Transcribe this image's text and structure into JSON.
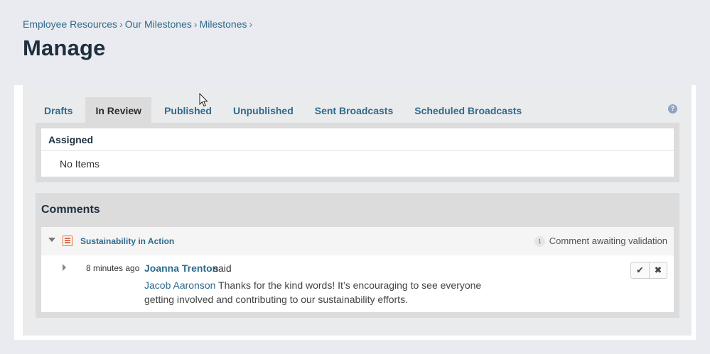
{
  "breadcrumb": {
    "items": [
      "Employee Resources",
      "Our Milestones",
      "Milestones"
    ],
    "separator": "›"
  },
  "page": {
    "title": "Manage"
  },
  "tabs": [
    {
      "label": "Drafts",
      "active": false
    },
    {
      "label": "In Review",
      "active": true
    },
    {
      "label": "Published",
      "active": false
    },
    {
      "label": "Unpublished",
      "active": false
    },
    {
      "label": "Sent Broadcasts",
      "active": false
    },
    {
      "label": "Scheduled Broadcasts",
      "active": false
    }
  ],
  "help": {
    "glyph": "?"
  },
  "assigned": {
    "heading": "Assigned",
    "empty_text": "No Items"
  },
  "comments": {
    "heading": "Comments",
    "group": {
      "title": "Sustainability in Action",
      "count": "1",
      "status": "Comment awaiting validation"
    },
    "comment": {
      "time": "8 minutes ago",
      "author": "Joanna Trenton",
      "said": "said",
      "mention": "Jacob Aaronson",
      "text": " Thanks for the kind words! It’s encouraging to see everyone getting involved and contributing to our sustainability efforts."
    },
    "actions": {
      "approve": "✔",
      "reject": "✖"
    }
  },
  "colors": {
    "link": "#2f6a8c",
    "title": "#1e2f3e",
    "background": "#eaebf0",
    "icon_accent": "#e1704a"
  }
}
